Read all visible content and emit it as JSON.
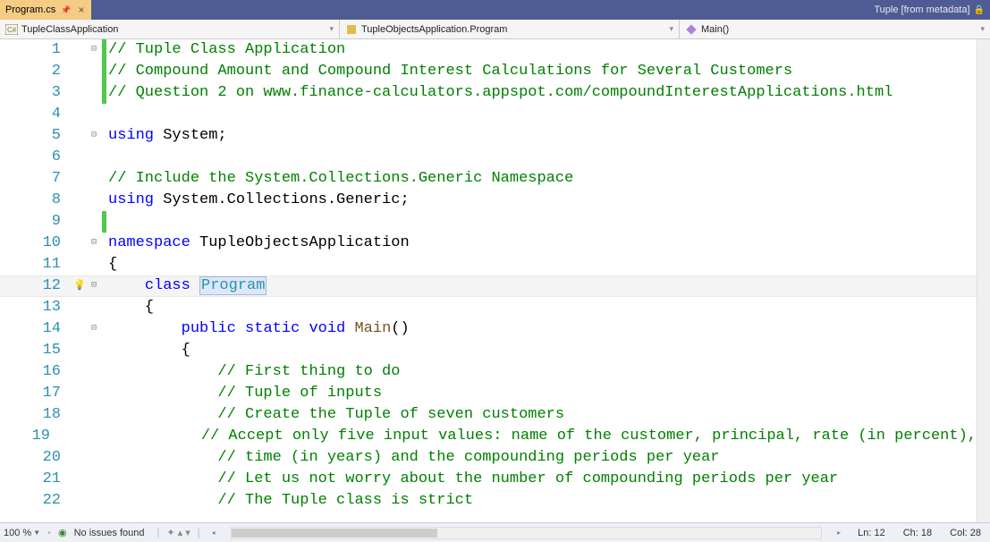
{
  "tab": {
    "title": "Program.cs"
  },
  "metadata_label": "Tuple [from metadata]",
  "nav": {
    "project": "TupleClassApplication",
    "class": "TupleObjectsApplication.Program",
    "method": "Main()"
  },
  "code": {
    "lines": [
      {
        "n": 1,
        "fold": "⊟",
        "bar": "green",
        "tokens": [
          {
            "t": "// Tuple Class Application",
            "c": "comment"
          }
        ]
      },
      {
        "n": 2,
        "fold": "",
        "bar": "green",
        "tokens": [
          {
            "t": "// Compound Amount and Compound Interest Calculations for Several Customers",
            "c": "comment"
          }
        ]
      },
      {
        "n": 3,
        "fold": "",
        "bar": "green",
        "tokens": [
          {
            "t": "// Question 2 on www.finance-calculators.appspot.com/compoundInterestApplications.html",
            "c": "comment"
          }
        ]
      },
      {
        "n": 4,
        "fold": "",
        "bar": "",
        "tokens": []
      },
      {
        "n": 5,
        "fold": "⊟",
        "bar": "",
        "tokens": [
          {
            "t": "using ",
            "c": "keyword"
          },
          {
            "t": "System;",
            "c": "ident"
          }
        ]
      },
      {
        "n": 6,
        "fold": "",
        "bar": "",
        "tokens": []
      },
      {
        "n": 7,
        "fold": "",
        "bar": "",
        "tokens": [
          {
            "t": "// Include the System.Collections.Generic Namespace",
            "c": "comment"
          }
        ]
      },
      {
        "n": 8,
        "fold": "",
        "bar": "",
        "tokens": [
          {
            "t": "using ",
            "c": "keyword"
          },
          {
            "t": "System.Collections.Generic;",
            "c": "ident"
          }
        ]
      },
      {
        "n": 9,
        "fold": "",
        "bar": "green",
        "tokens": []
      },
      {
        "n": 10,
        "fold": "⊟",
        "bar": "",
        "tokens": [
          {
            "t": "namespace ",
            "c": "keyword"
          },
          {
            "t": "TupleObjectsApplication",
            "c": "ident"
          }
        ]
      },
      {
        "n": 11,
        "fold": "",
        "bar": "",
        "tokens": [
          {
            "t": "{",
            "c": "ident"
          }
        ]
      },
      {
        "n": 12,
        "fold": "⊟",
        "bar": "",
        "hl": true,
        "bulb": true,
        "tokens": [
          {
            "t": "    ",
            "c": "ident"
          },
          {
            "t": "class ",
            "c": "keyword"
          },
          {
            "t": "Program",
            "c": "type",
            "sel": true
          }
        ]
      },
      {
        "n": 13,
        "fold": "",
        "bar": "",
        "tokens": [
          {
            "t": "    {",
            "c": "ident"
          }
        ]
      },
      {
        "n": 14,
        "fold": "⊟",
        "bar": "",
        "tokens": [
          {
            "t": "        ",
            "c": "ident"
          },
          {
            "t": "public static void ",
            "c": "keyword"
          },
          {
            "t": "Main",
            "c": "method"
          },
          {
            "t": "()",
            "c": "ident"
          }
        ]
      },
      {
        "n": 15,
        "fold": "",
        "bar": "",
        "tokens": [
          {
            "t": "        {",
            "c": "ident"
          }
        ]
      },
      {
        "n": 16,
        "fold": "",
        "bar": "",
        "tokens": [
          {
            "t": "            ",
            "c": "ident"
          },
          {
            "t": "// First thing to do",
            "c": "comment"
          }
        ]
      },
      {
        "n": 17,
        "fold": "",
        "bar": "",
        "tokens": [
          {
            "t": "            ",
            "c": "ident"
          },
          {
            "t": "// Tuple of inputs",
            "c": "comment"
          }
        ]
      },
      {
        "n": 18,
        "fold": "",
        "bar": "",
        "tokens": [
          {
            "t": "            ",
            "c": "ident"
          },
          {
            "t": "// Create the Tuple of seven customers",
            "c": "comment"
          }
        ]
      },
      {
        "n": 19,
        "fold": "",
        "bar": "",
        "tokens": [
          {
            "t": "            ",
            "c": "ident"
          },
          {
            "t": "// Accept only five input values: name of the customer, principal, rate (in percent),",
            "c": "comment"
          }
        ]
      },
      {
        "n": 20,
        "fold": "",
        "bar": "",
        "tokens": [
          {
            "t": "            ",
            "c": "ident"
          },
          {
            "t": "// time (in years) and the compounding periods per year",
            "c": "comment"
          }
        ]
      },
      {
        "n": 21,
        "fold": "",
        "bar": "",
        "tokens": [
          {
            "t": "            ",
            "c": "ident"
          },
          {
            "t": "// Let us not worry about the number of compounding periods per year",
            "c": "comment"
          }
        ]
      },
      {
        "n": 22,
        "fold": "",
        "bar": "",
        "tokens": [
          {
            "t": "            ",
            "c": "ident"
          },
          {
            "t": "// The Tuple class is strict",
            "c": "comment"
          }
        ]
      }
    ]
  },
  "status": {
    "zoom": "100 %",
    "issues": "No issues found",
    "ln": "Ln: 12",
    "ch": "Ch: 18",
    "col": "Col: 28"
  }
}
